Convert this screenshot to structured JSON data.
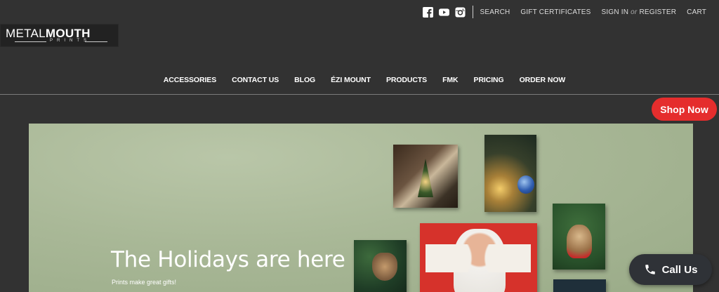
{
  "topbar": {
    "social": [
      "facebook-icon",
      "youtube-icon",
      "instagram-icon"
    ],
    "search": "SEARCH",
    "gift_certificates": "GIFT CERTIFICATES",
    "sign_in": "SIGN IN",
    "or": "or",
    "register": "REGISTER",
    "cart": "CART"
  },
  "logo": {
    "main_thin": "METAL",
    "main_bold": "MOUTH",
    "sub": "PRINTS"
  },
  "nav": {
    "items": [
      "ACCESSORIES",
      "CONTACT US",
      "BLOG",
      "ÉZI MOUNT",
      "PRODUCTS",
      "FMK",
      "PRICING",
      "ORDER NOW"
    ]
  },
  "shop_now": "Shop Now",
  "hero": {
    "title": "The Holidays are here",
    "subtitle": "Prints make great gifts!"
  },
  "call_us": {
    "label": "Call Us",
    "icon": "phone-icon"
  },
  "colors": {
    "background": "#323232",
    "accent_red": "#e52d2d",
    "hero_wall": "#a9b897"
  }
}
